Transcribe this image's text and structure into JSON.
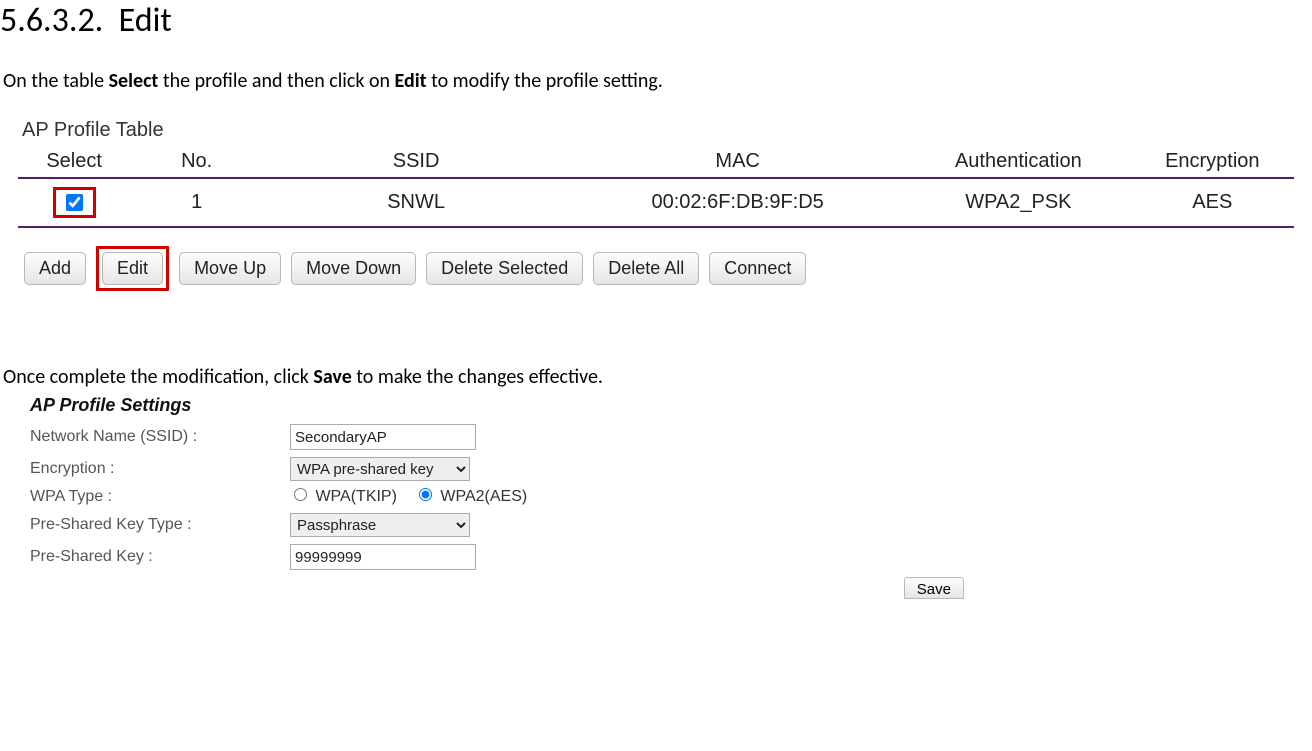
{
  "heading": {
    "number": "5.6.3.2.",
    "title": "Edit"
  },
  "instruction1": {
    "pre": "On the table ",
    "b1": "Select",
    "mid": " the profile and then click on ",
    "b2": "Edit",
    "post": " to modify the profile setting."
  },
  "profileTable": {
    "title": "AP Profile Table",
    "headers": {
      "select": "Select",
      "no": "No.",
      "ssid": "SSID",
      "mac": "MAC",
      "auth": "Authentication",
      "enc": "Encryption"
    },
    "row": {
      "selected": true,
      "no": "1",
      "ssid": "SNWL",
      "mac": "00:02:6F:DB:9F:D5",
      "auth": "WPA2_PSK",
      "enc": "AES"
    },
    "buttons": {
      "add": "Add",
      "edit": "Edit",
      "moveUp": "Move Up",
      "moveDown": "Move Down",
      "deleteSelected": "Delete Selected",
      "deleteAll": "Delete All",
      "connect": "Connect"
    }
  },
  "instruction2": {
    "pre": "Once complete the modification, click ",
    "b1": "Save",
    "post": " to make the changes effective."
  },
  "settings": {
    "title": "AP Profile Settings",
    "labels": {
      "ssid": "Network Name (SSID) :",
      "encryption": "Encryption :",
      "wpaType": "WPA Type :",
      "pskType": "Pre-Shared Key Type :",
      "psk": "Pre-Shared Key :"
    },
    "values": {
      "ssid": "SecondaryAP",
      "encryption": "WPA pre-shared key",
      "wpaTkip": "WPA(TKIP)",
      "wpaAes": "WPA2(AES)",
      "pskType": "Passphrase",
      "psk": "99999999"
    },
    "saveLabel": "Save"
  }
}
